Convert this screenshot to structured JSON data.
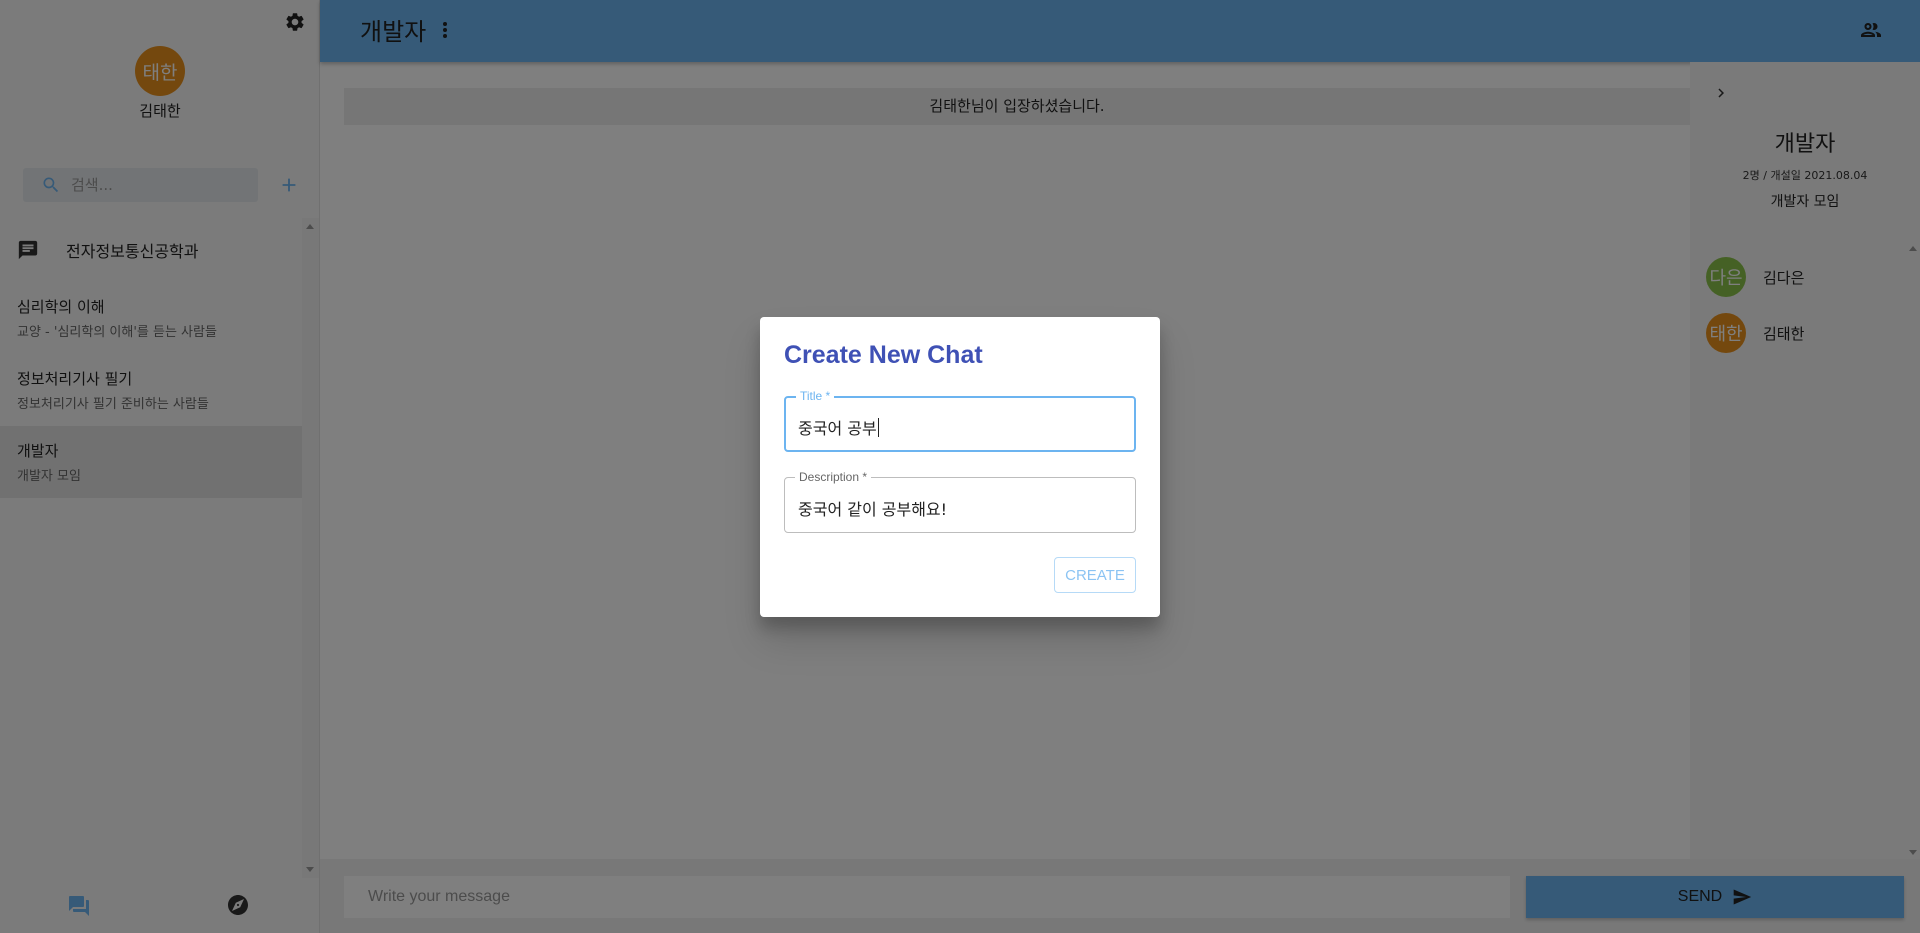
{
  "sidebar": {
    "profile": {
      "avatar_text": "태한",
      "name": "김태한"
    },
    "search": {
      "placeholder": "검색..."
    },
    "section_header": "전자정보통신공학과",
    "chats": [
      {
        "title": "심리학의 이해",
        "description": "교양 - '심리학의 이해'를 듣는 사람들"
      },
      {
        "title": "정보처리기사 필기",
        "description": "정보처리기사 필기 준비하는 사람들"
      },
      {
        "title": "개발자",
        "description": "개발자 모임"
      }
    ]
  },
  "header": {
    "title": "개발자"
  },
  "main": {
    "system_message": "김태한님이 입장하셨습니다."
  },
  "info_panel": {
    "title": "개발자",
    "meta": "2명 / 개설일 2021.08.04",
    "description": "개발자 모임",
    "members": [
      {
        "avatar_text": "다은",
        "name": "김다은",
        "color": "#8bc34a"
      },
      {
        "avatar_text": "태한",
        "name": "김태한",
        "color": "#e8901c"
      }
    ]
  },
  "composer": {
    "placeholder": "Write your message",
    "send_label": "SEND"
  },
  "dialog": {
    "title": "Create New Chat",
    "title_field": {
      "label": "Title *",
      "value": "중국어 공부"
    },
    "description_field": {
      "label": "Description *",
      "value": "중국어 같이 공부해요!"
    },
    "create_label": "CREATE"
  },
  "colors": {
    "primary": "#6cb4f0",
    "dialog_title": "#3f51b5",
    "avatar_orange": "#e8901c",
    "avatar_green": "#8bc34a"
  },
  "icons": [
    "gear-icon",
    "search-icon",
    "add-icon",
    "chat-icon",
    "forum-icon",
    "compass-icon",
    "more-vert-icon",
    "people-icon",
    "chevron-right-icon",
    "send-icon"
  ]
}
